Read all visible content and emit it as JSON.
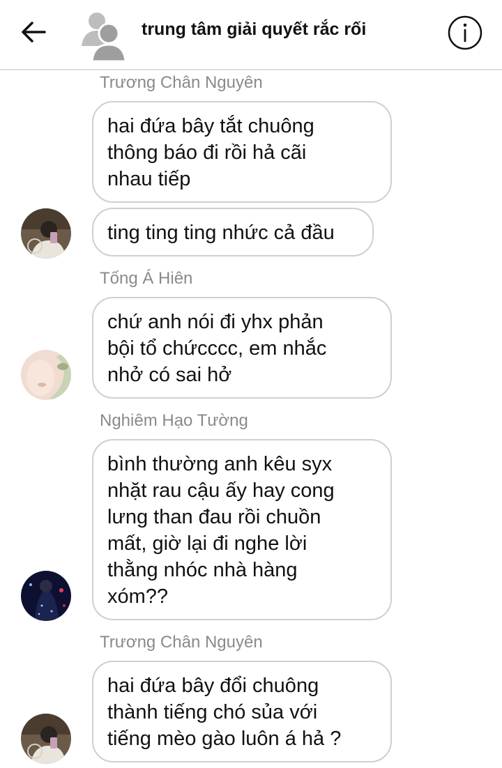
{
  "header": {
    "title": "trung tâm giải quyết rắc rối",
    "back_icon": "arrow-left-icon",
    "group_avatar_icon": "group-avatar-icon",
    "info_icon": "info-icon"
  },
  "messages": [
    {
      "sender": "Trương Chân Nguyên",
      "bubbles": [
        {
          "lines": [
            "hai đứa bây tắt chuông",
            "thông báo đi rồi hả cãi",
            "nhau tiếp"
          ]
        },
        {
          "lines": [
            "ting ting ting nhức cả đầu"
          ]
        }
      ]
    },
    {
      "sender": "Tống Á Hiên",
      "bubbles": [
        {
          "lines": [
            "chứ anh nói đi yhx phản",
            "bội tổ chứcccc, em nhắc",
            "nhở có sai hở"
          ]
        }
      ]
    },
    {
      "sender": "Nghiêm Hạo Tường",
      "bubbles": [
        {
          "lines": [
            "bình thường anh kêu syx",
            "nhặt rau cậu ấy hay cong",
            "lưng than đau rồi chuồn",
            "mất, giờ lại đi nghe lời",
            "thằng nhóc nhà hàng",
            "xóm??"
          ]
        }
      ]
    },
    {
      "sender": "Trương Chân Nguyên",
      "bubbles": [
        {
          "lines": [
            "hai đứa bây đổi chuông",
            "thành tiếng chó sủa với",
            "tiếng mèo gào luôn á hả ?"
          ]
        }
      ]
    }
  ],
  "colors": {
    "bubble_border": "#cfcfcf",
    "sender_text": "#8a8a8a",
    "message_text": "#111111",
    "header_divider": "#dcdcdc"
  }
}
